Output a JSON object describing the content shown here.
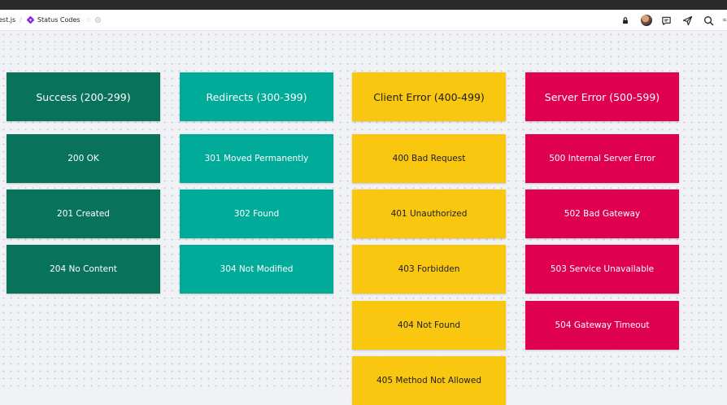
{
  "toolbar": {
    "file_name": "est.js",
    "separator": "/",
    "board_title": "Status Codes",
    "star_icon": "star-icon",
    "settings_icon": "gear-icon",
    "lock_icon": "lock-icon",
    "comment_icon": "comment-icon",
    "share_icon": "send-icon",
    "search_icon": "search-icon"
  },
  "colors": {
    "success": "#08735a",
    "redirects": "#00ab9a",
    "client_error": "#fac710",
    "server_error": "#df0150"
  },
  "columns": [
    {
      "header": "Success (200-299)",
      "items": [
        "200 OK",
        "201 Created",
        "204 No Content"
      ]
    },
    {
      "header": "Redirects (300-399)",
      "items": [
        "301 Moved Permanently",
        "302 Found",
        "304 Not Modified"
      ]
    },
    {
      "header": "Client Error (400-499)",
      "items": [
        "400 Bad Request",
        "401 Unauthorized",
        "403 Forbidden",
        "404 Not Found",
        "405 Method Not Allowed"
      ]
    },
    {
      "header": "Server Error (500-599)",
      "items": [
        "500 Internal Server Error",
        "502 Bad Gateway",
        "503 Service Unavailable",
        "504 Gateway Timeout"
      ]
    }
  ]
}
